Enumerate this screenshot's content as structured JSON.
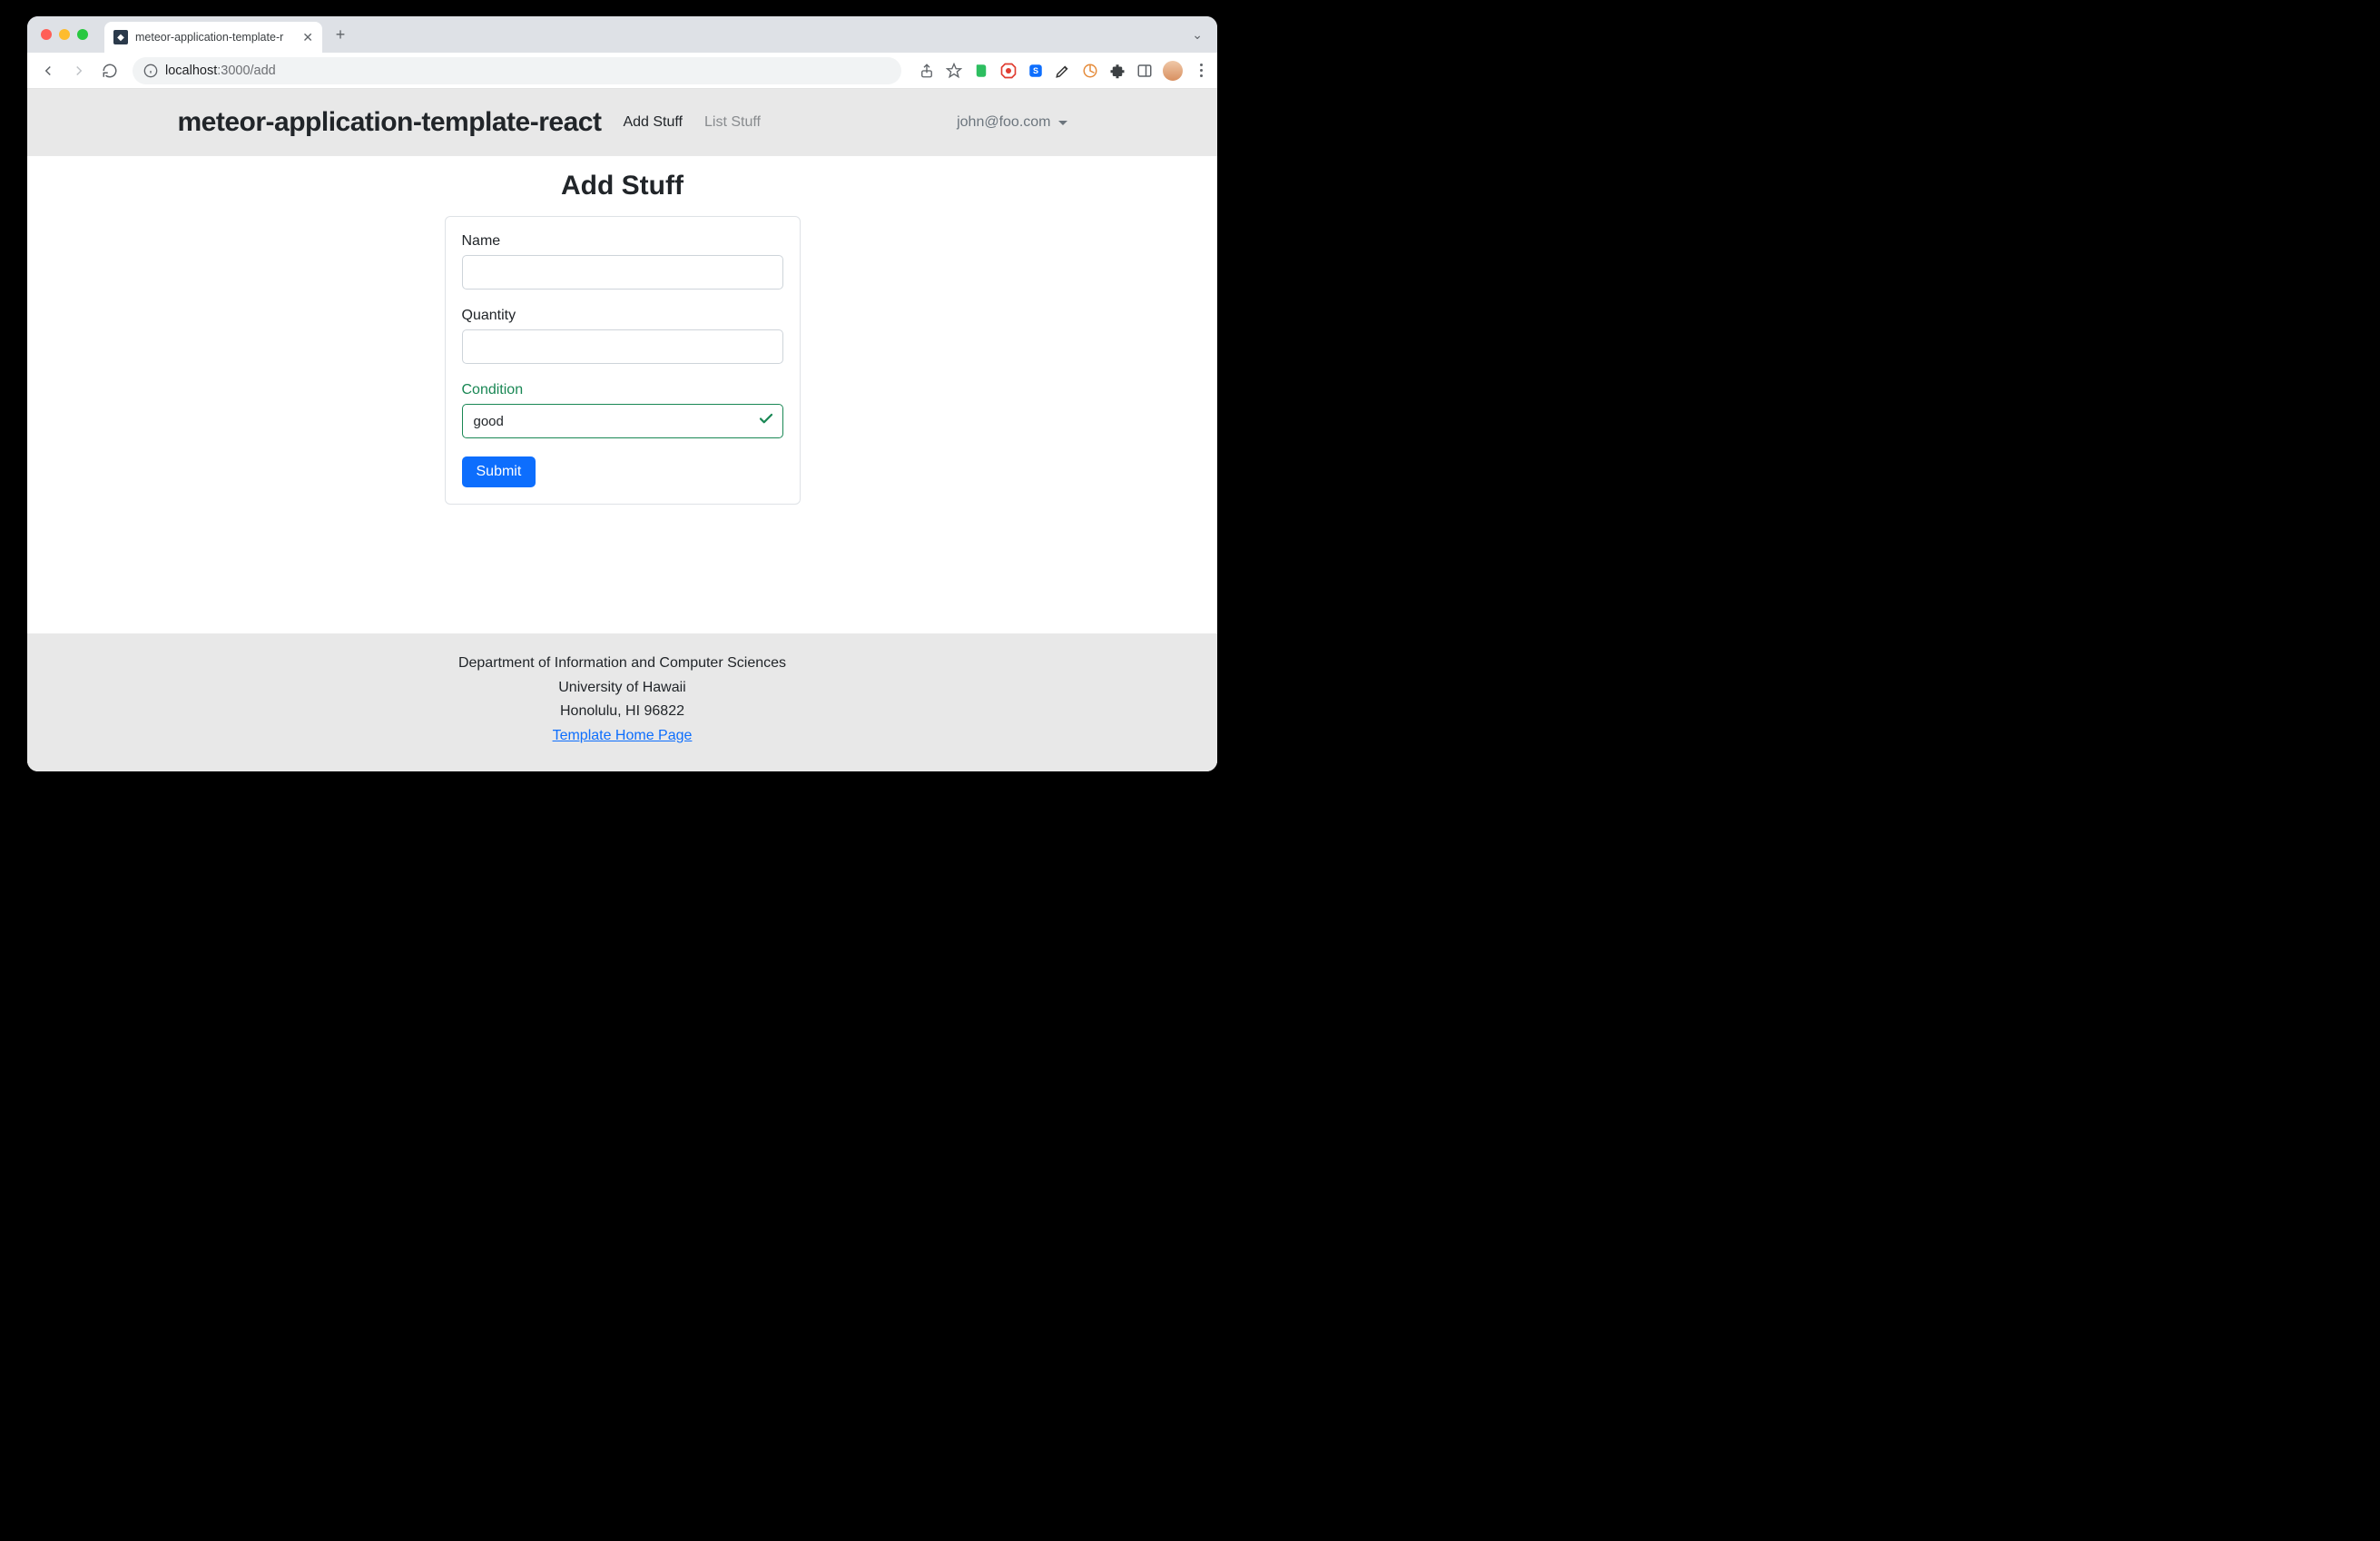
{
  "browser": {
    "tab_title": "meteor-application-template-r",
    "url_host": "localhost",
    "url_port_path": ":3000/add"
  },
  "navbar": {
    "brand": "meteor-application-template-react",
    "links": {
      "add": "Add Stuff",
      "list": "List Stuff"
    },
    "user": "john@foo.com"
  },
  "page": {
    "title": "Add Stuff"
  },
  "form": {
    "name": {
      "label": "Name",
      "value": ""
    },
    "quantity": {
      "label": "Quantity",
      "value": ""
    },
    "condition": {
      "label": "Condition",
      "value": "good"
    },
    "submit_label": "Submit"
  },
  "footer": {
    "line1": "Department of Information and Computer Sciences",
    "line2": "University of Hawaii",
    "line3": "Honolulu, HI 96822",
    "link_text": "Template Home Page"
  }
}
